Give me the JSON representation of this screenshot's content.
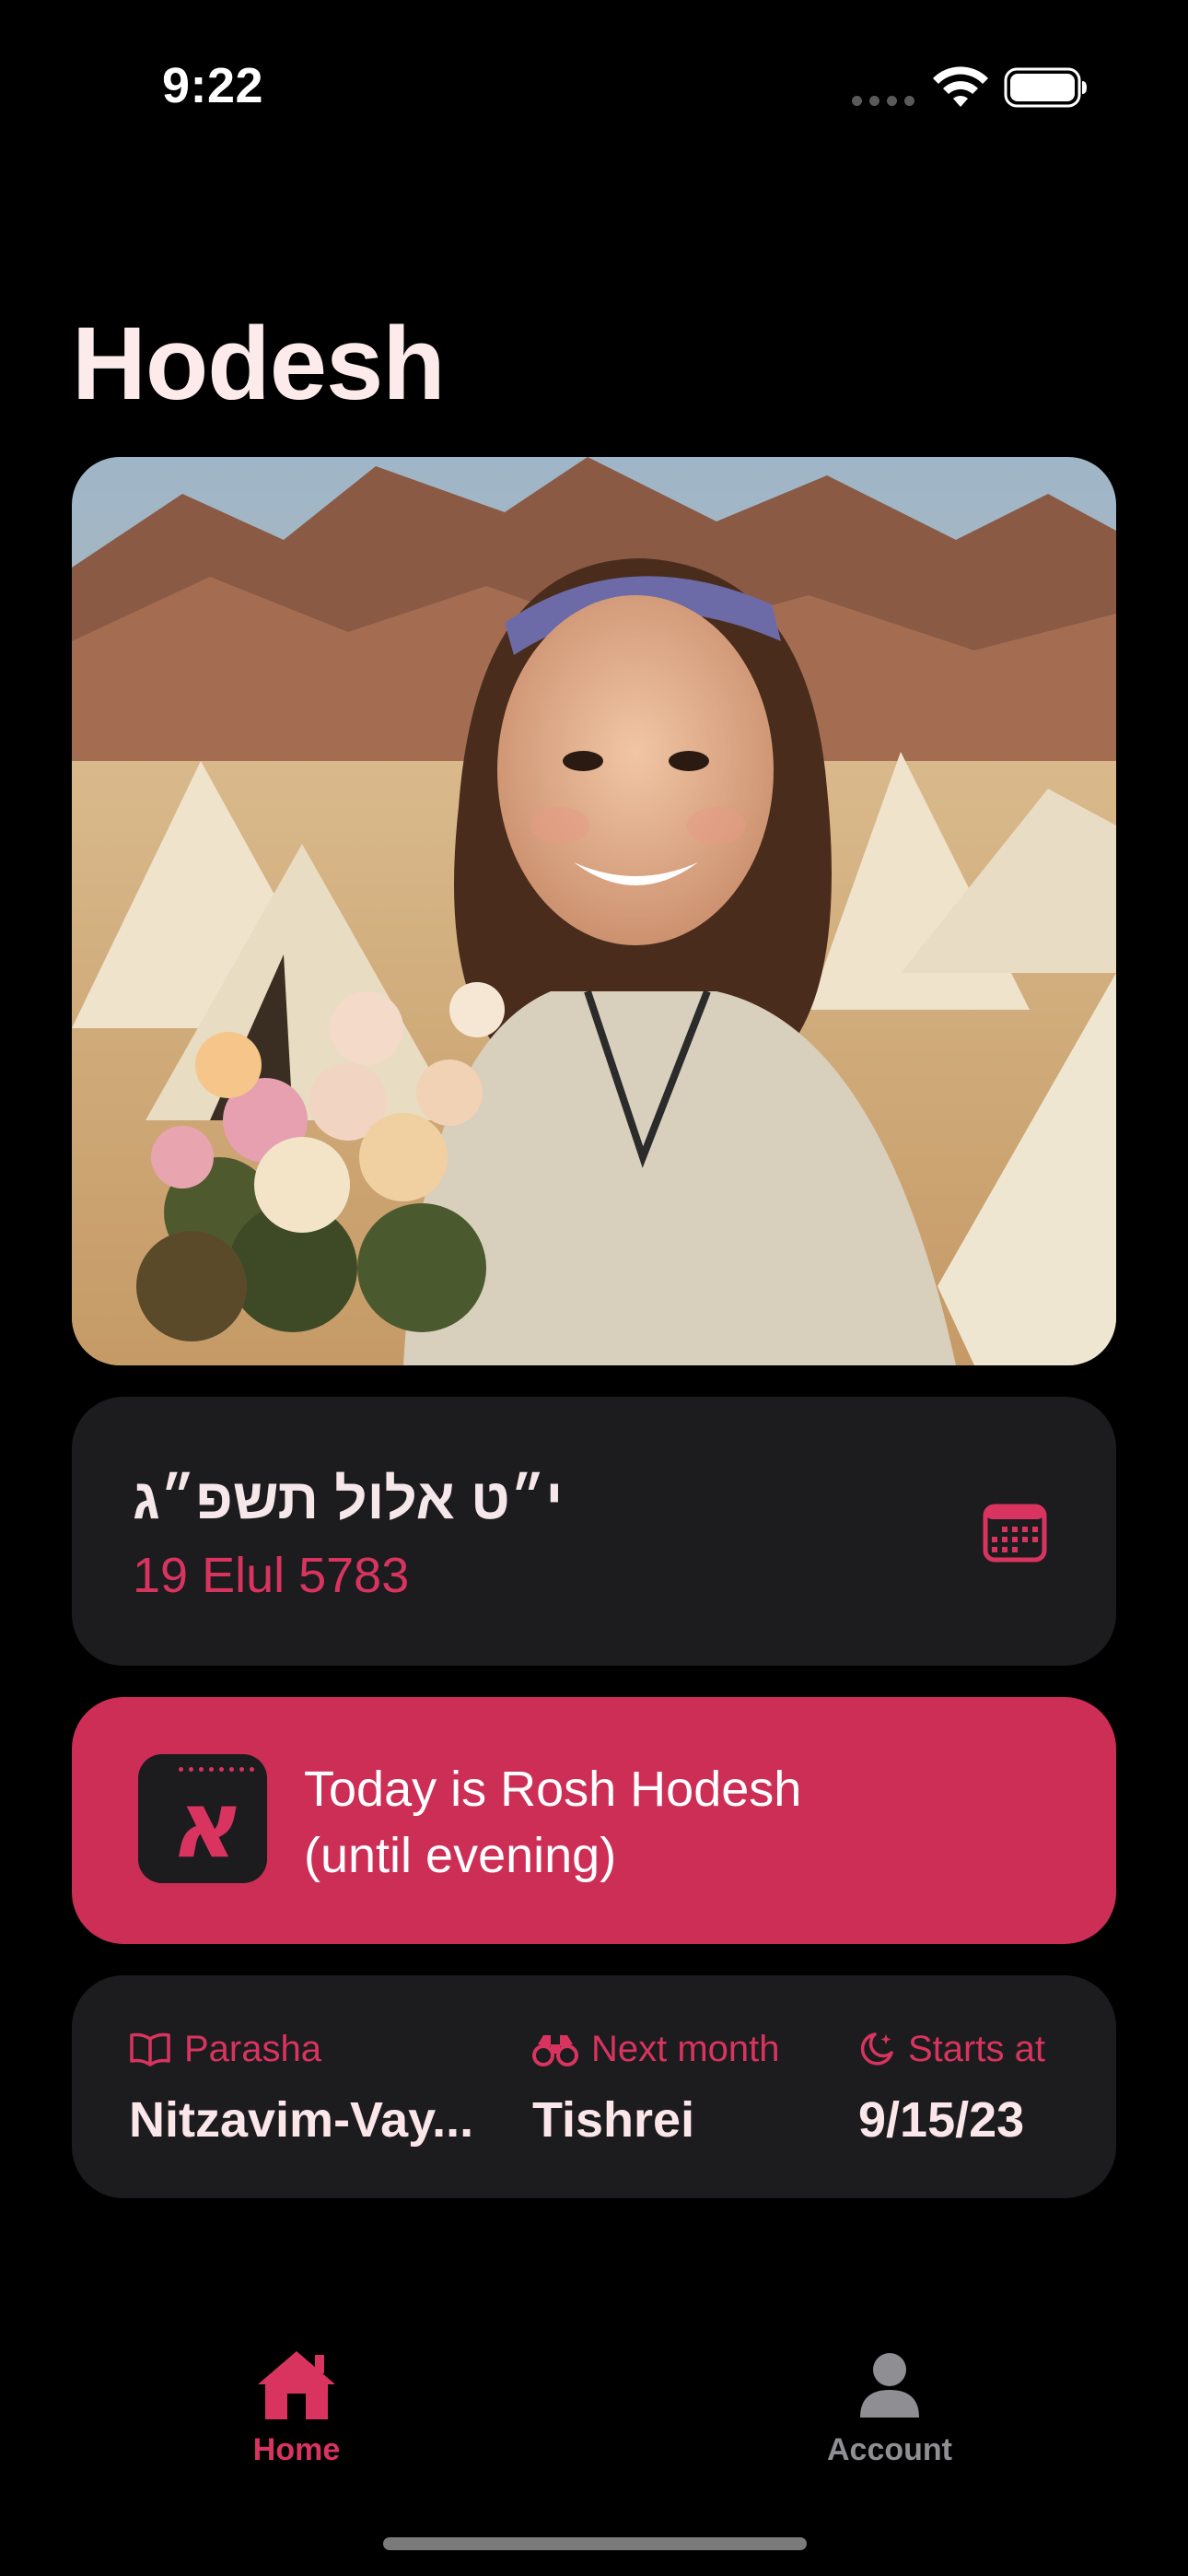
{
  "status_bar": {
    "time": "9:22"
  },
  "page": {
    "title": "Hodesh"
  },
  "date_card": {
    "hebrew_date": "י״ט אלול תשפ״ג",
    "gregorian_transliteration": "19 Elul 5783",
    "calendar_icon": "calendar-icon"
  },
  "banner": {
    "badge_glyph": "א",
    "line1": "Today is Rosh Hodesh",
    "line2": "(until evening)",
    "background_color": "#cd2e56"
  },
  "info": {
    "parasha_label": "Parasha",
    "parasha_value": "Nitzavim-Vay...",
    "next_month_label": "Next month",
    "next_month_value": "Tishrei",
    "starts_label": "Starts at",
    "starts_value": "9/15/23"
  },
  "tabs": {
    "home_label": "Home",
    "account_label": "Account",
    "active": "Home"
  },
  "colors": {
    "accent": "#d8345f",
    "card": "#1c1c1e",
    "background": "#000000"
  }
}
